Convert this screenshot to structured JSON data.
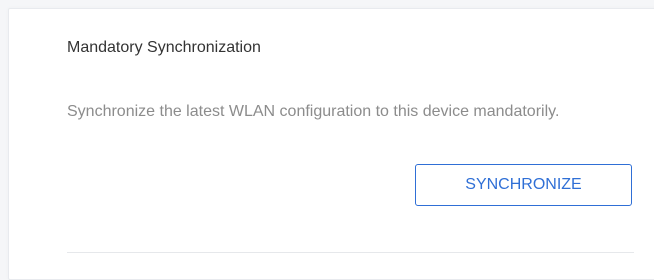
{
  "section": {
    "title": "Mandatory Synchronization",
    "description": "Synchronize the latest WLAN configuration to this device mandatorily.",
    "button_label": "SYNCHRONIZE"
  },
  "colors": {
    "accent": "#2f6fd6",
    "title_text": "#333333",
    "description_text": "#8c8c8c",
    "divider": "#e6e8eb"
  }
}
